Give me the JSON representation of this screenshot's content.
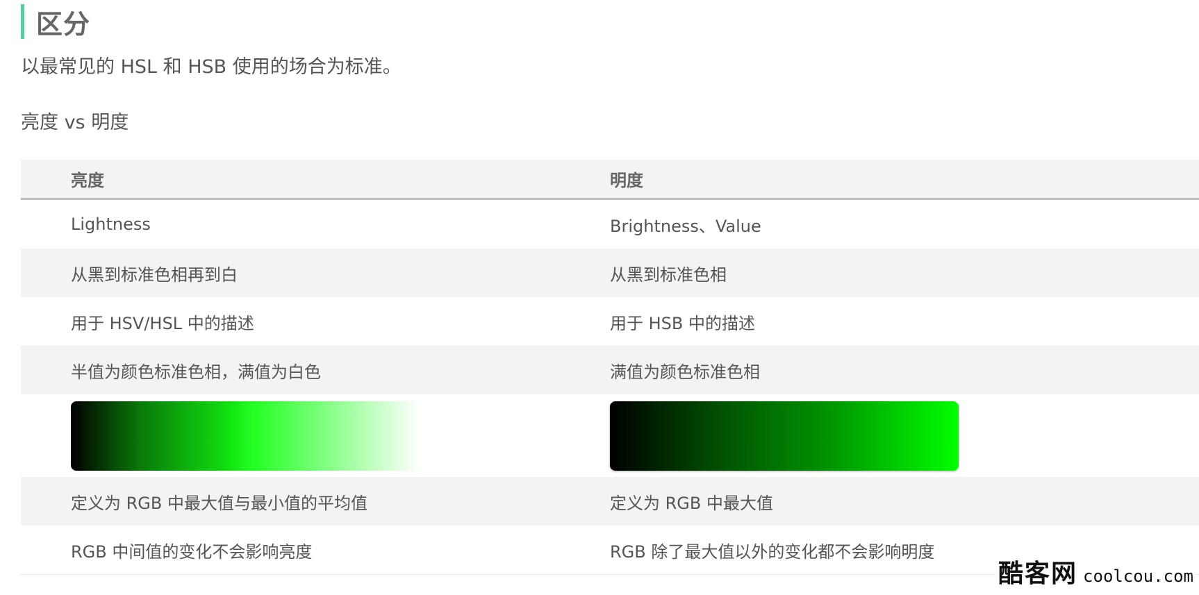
{
  "heading": "区分",
  "intro": "以最常见的 HSL 和 HSB 使用的场合为标准。",
  "subheading": "亮度 vs 明度",
  "table": {
    "headers": [
      "亮度",
      "明度"
    ],
    "rows": [
      [
        "Lightness",
        "Brightness、Value"
      ],
      [
        "从黑到标准色相再到白",
        "从黑到标准色相"
      ],
      [
        "用于 HSV/HSL 中的描述",
        "用于 HSB 中的描述"
      ],
      [
        "半值为颜色标准色相，满值为白色",
        "满值为颜色标准色相"
      ],
      [
        "定义为 RGB 中最大值与最小值的平均值",
        "定义为 RGB 中最大值"
      ],
      [
        "RGB 中间值的变化不会影响亮度",
        "RGB 除了最大值以外的变化都不会影响明度"
      ]
    ]
  },
  "swatches": {
    "lightness": {
      "from": "#000000",
      "mid": "#00ff00",
      "to": "#ffffff"
    },
    "brightness": {
      "from": "#000000",
      "to": "#00ff00"
    }
  },
  "watermark": {
    "cn": "酷客网",
    "en": "coolcou.com"
  }
}
